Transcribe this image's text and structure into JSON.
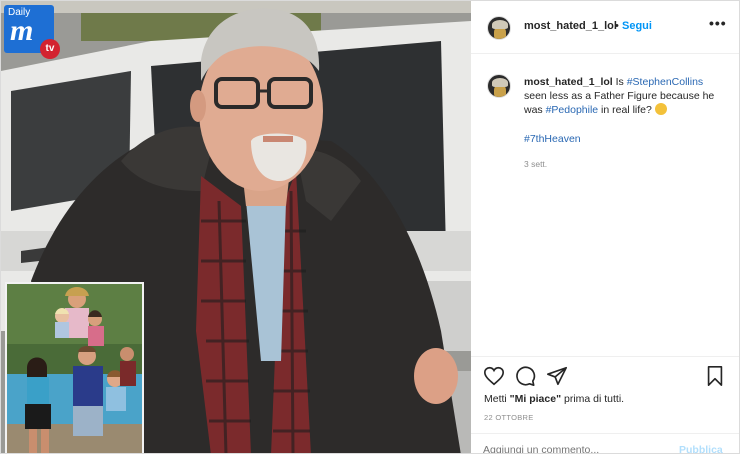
{
  "logo": {
    "daily": "Daily",
    "m": "m",
    "tv": "tv"
  },
  "post": {
    "username": "most_hated_1_lol",
    "separator": "•",
    "follow_label": "Segui",
    "more_label": "•••",
    "caption_parts": [
      {
        "text": "Is ",
        "kind": "plain"
      },
      {
        "text": "#StephenCollins",
        "kind": "tag"
      },
      {
        "text": " seen less as a Father Figure because he was ",
        "kind": "plain"
      },
      {
        "text": "#Pedophile",
        "kind": "tag"
      },
      {
        "text": " in real life? ",
        "kind": "plain"
      }
    ],
    "hashtag": "#7thHeaven",
    "time_ago": "3 sett.",
    "likes_prefix": "Metti ",
    "likes_bold": "\"Mi piace\"",
    "likes_suffix": " prima di tutti.",
    "date": "22 OTTOBRE",
    "comment_placeholder": "Aggiungi un commento...",
    "publish_label": "Pubblica"
  },
  "icons": {
    "like": "heart-icon",
    "comment": "comment-icon",
    "share": "paper-plane-icon",
    "save": "bookmark-icon",
    "emoji": "thinking-face-emoji"
  },
  "colors": {
    "link_blue": "#0095f6",
    "tag_blue": "#2a68b3",
    "logo_blue": "#1e6fd4",
    "logo_red": "#d32330"
  }
}
